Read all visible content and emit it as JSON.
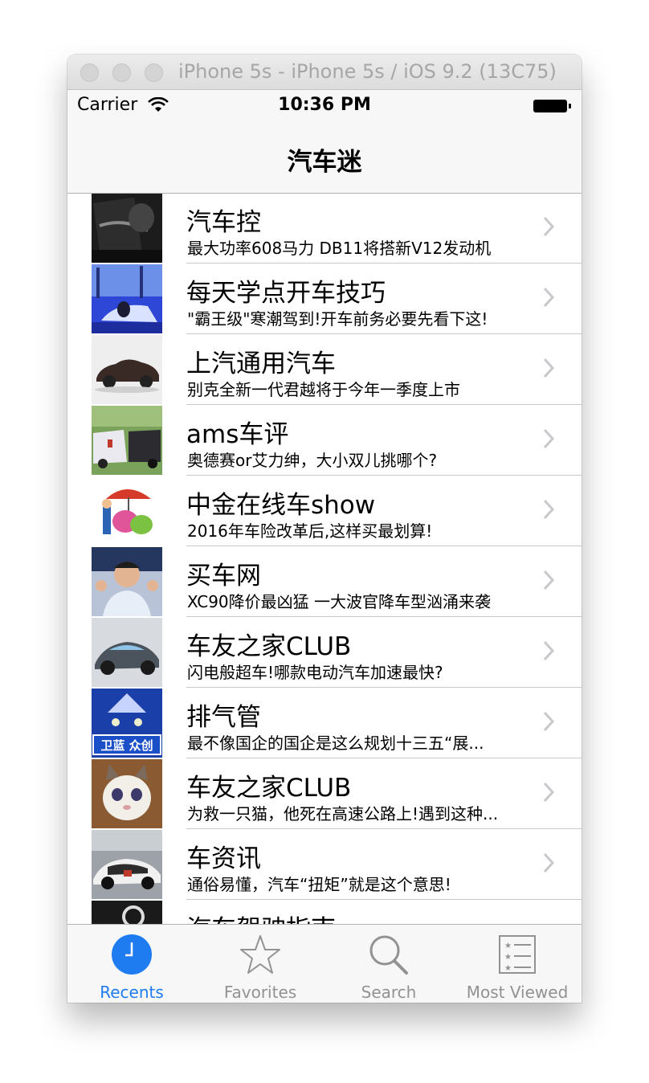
{
  "window": {
    "title": "iPhone 5s - iPhone 5s / iOS 9.2 (13C75)"
  },
  "status_bar": {
    "carrier": "Carrier",
    "time": "10:36 PM"
  },
  "nav": {
    "title": "汽车迷"
  },
  "list": {
    "items": [
      {
        "title": "汽车控",
        "subtitle": "最大功率608马力 DB11将搭新V12发动机"
      },
      {
        "title": "每天学点开车技巧",
        "subtitle": "\"霸王级\"寒潮驾到!开车前务必要先看下这!"
      },
      {
        "title": "上汽通用汽车",
        "subtitle": "别克全新一代君越将于今年一季度上市"
      },
      {
        "title": "ams车评",
        "subtitle": "奥德赛or艾力绅，大小双儿挑哪个?"
      },
      {
        "title": "中金在线车show",
        "subtitle": "2016年车险改革后,这样买最划算!"
      },
      {
        "title": "买车网",
        "subtitle": "XC90降价最凶猛 一大波官降车型汹涌来袭"
      },
      {
        "title": "车友之家CLUB",
        "subtitle": "闪电般超车!哪款电动汽车加速最快?"
      },
      {
        "title": "排气管",
        "subtitle": "最不像国企的国企是这么规划十三五“展..."
      },
      {
        "title": "车友之家CLUB",
        "subtitle": "为救一只猫，他死在高速公路上!遇到这种..."
      },
      {
        "title": "车资讯",
        "subtitle": "通俗易懂，汽车“扭矩”就是这个意思!"
      },
      {
        "title": "汽车驾驶指南",
        "subtitle": ""
      }
    ],
    "thumb_text": {
      "banner": "卫蓝 众创"
    }
  },
  "tabbar": {
    "tabs": [
      {
        "label": "Recents",
        "icon": "clock-icon",
        "active": true
      },
      {
        "label": "Favorites",
        "icon": "star-icon",
        "active": false
      },
      {
        "label": "Search",
        "icon": "search-icon",
        "active": false
      },
      {
        "label": "Most Viewed",
        "icon": "list-icon",
        "active": false
      }
    ]
  },
  "colors": {
    "tint": "#1f7cf0",
    "inactive": "#929292",
    "separator": "#c8c7cc"
  }
}
